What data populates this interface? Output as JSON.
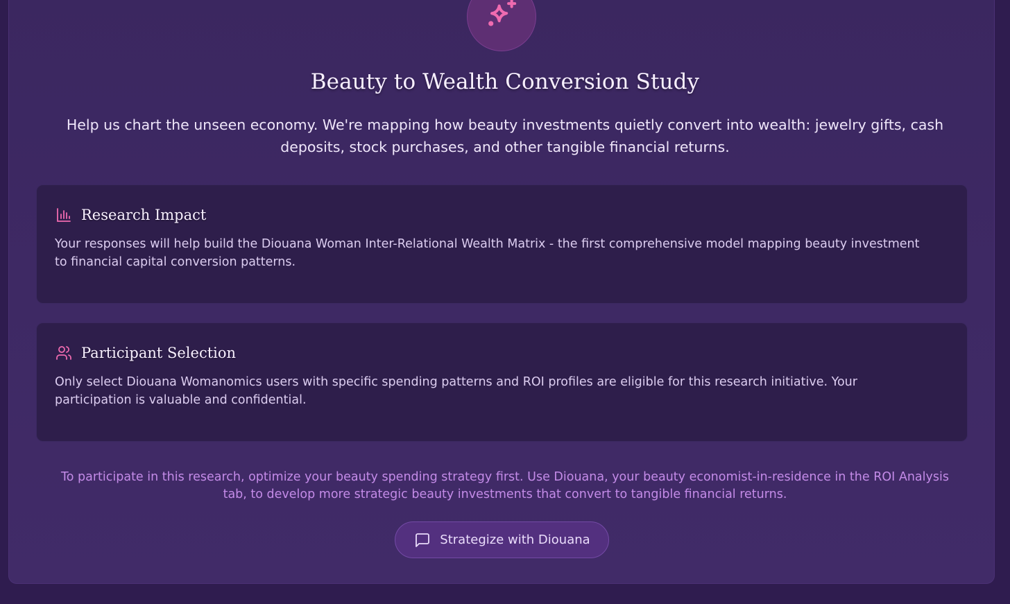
{
  "study": {
    "title": "Beauty to Wealth Conversion Study",
    "subtitle": "Help us chart the unseen economy. We're mapping how beauty investments quietly convert into wealth: jewelry gifts, cash deposits, stock purchases, and other tangible financial returns.",
    "hero_icon": "sparkles-icon"
  },
  "cards": [
    {
      "icon": "bar-chart-icon",
      "title": "Research Impact",
      "text": "Your responses will help build the Diouana Woman Inter-Relational Wealth Matrix - the first comprehensive model mapping beauty investment to financial capital conversion patterns."
    },
    {
      "icon": "users-icon",
      "title": "Participant Selection",
      "text": "Only select Diouana Womanomics users with specific spending patterns and ROI profiles are eligible for this research initiative. Your participation is valuable and confidential."
    }
  ],
  "cta": {
    "note": "To participate in this research, optimize your beauty spending strategy first. Use Diouana, your beauty economist-in-residence in the ROI Analysis tab, to develop more strategic beauty investments that convert to tangible financial returns.",
    "button_label": "Strategize with Diouana",
    "button_icon": "message-square-icon"
  },
  "colors": {
    "background": "#2f1c4f",
    "card": "#2e1e4b",
    "accent_pink": "#f06bb0",
    "accent_text": "#c48be8",
    "button": "#53307f"
  }
}
